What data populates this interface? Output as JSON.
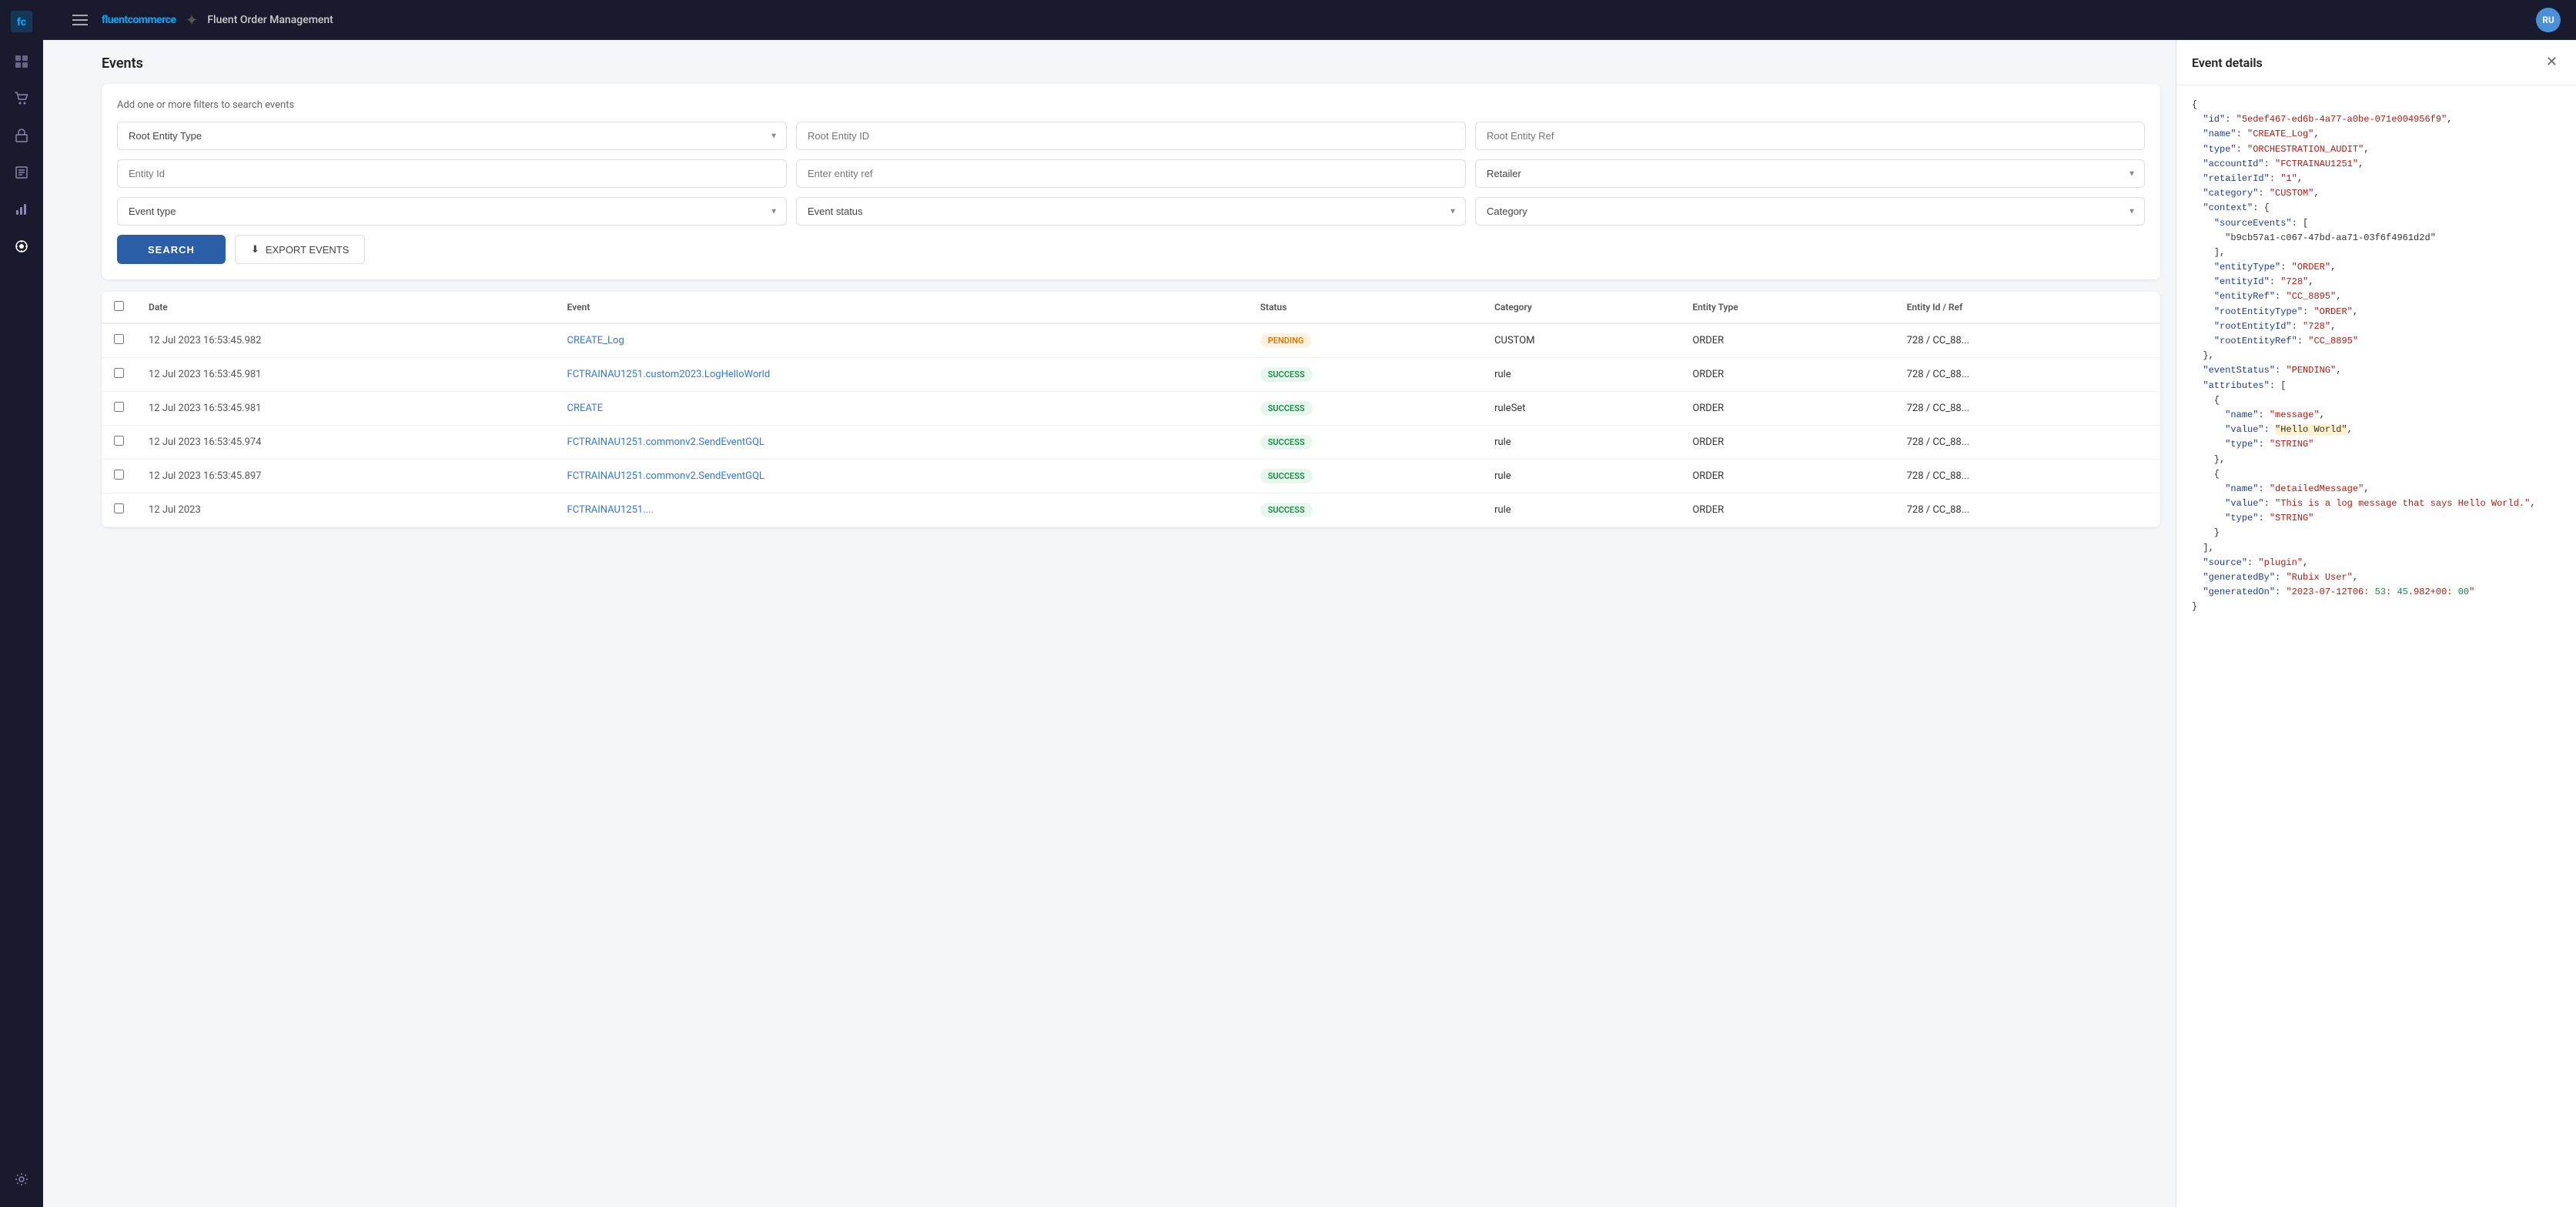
{
  "app": {
    "brand": "fluentcommerce",
    "title": "Fluent Order Management",
    "logo_symbol": "≋"
  },
  "sidebar": {
    "icons": [
      {
        "name": "menu-icon",
        "symbol": "☰",
        "active": false
      },
      {
        "name": "dashboard-icon",
        "symbol": "⊞",
        "active": false
      },
      {
        "name": "orders-icon",
        "symbol": "🛒",
        "active": false
      },
      {
        "name": "inventory-icon",
        "symbol": "📦",
        "active": false
      },
      {
        "name": "catalog-icon",
        "symbol": "📋",
        "active": false
      },
      {
        "name": "reports-icon",
        "symbol": "📊",
        "active": false
      },
      {
        "name": "rules-icon",
        "symbol": "⚙",
        "active": true
      },
      {
        "name": "settings-icon",
        "symbol": "⚙",
        "active": false
      }
    ]
  },
  "page": {
    "title": "Events"
  },
  "filters": {
    "hint": "Add one or more filters to search events",
    "row1": {
      "root_entity_type_placeholder": "Root Entity Type",
      "root_entity_id_placeholder": "Root Entity ID",
      "root_entity_ref_placeholder": "Root Entity Ref"
    },
    "row2": {
      "entity_id_placeholder": "Entity Id",
      "entity_ref_placeholder": "Enter entity ref",
      "retailer_placeholder": "Retailer"
    },
    "row3": {
      "event_type_placeholder": "Event type",
      "event_status_placeholder": "Event status",
      "category_placeholder": "Category"
    },
    "search_label": "SEARCH",
    "export_label": "EXPORT EVENTS"
  },
  "table": {
    "columns": [
      "",
      "Date",
      "Event",
      "Status",
      "Category",
      "Entity Type",
      "Entity Id / Ref"
    ],
    "rows": [
      {
        "date": "12 Jul 2023 16:53:45.982",
        "event": "CREATE_Log",
        "event_link": true,
        "status": "PENDING",
        "status_type": "pending",
        "category": "CUSTOM",
        "entity_type": "ORDER",
        "entity_id_ref": "728 / CC_88..."
      },
      {
        "date": "12 Jul 2023 16:53:45.981",
        "event": "FCTRAINAU1251.custom2023.LogHelloWorld",
        "event_link": true,
        "status": "SUCCESS",
        "status_type": "success",
        "category": "rule",
        "entity_type": "ORDER",
        "entity_id_ref": "728 / CC_88..."
      },
      {
        "date": "12 Jul 2023 16:53:45.981",
        "event": "CREATE",
        "event_link": true,
        "status": "SUCCESS",
        "status_type": "success",
        "category": "ruleSet",
        "entity_type": "ORDER",
        "entity_id_ref": "728 / CC_88..."
      },
      {
        "date": "12 Jul 2023 16:53:45.974",
        "event": "FCTRAINAU1251.commonv2.SendEventGQL",
        "event_link": true,
        "status": "SUCCESS",
        "status_type": "success",
        "category": "rule",
        "entity_type": "ORDER",
        "entity_id_ref": "728 / CC_88..."
      },
      {
        "date": "12 Jul 2023 16:53:45.897",
        "event": "FCTRAINAU1251.commonv2.SendEventGQL",
        "event_link": true,
        "status": "SUCCESS",
        "status_type": "success",
        "category": "rule",
        "entity_type": "ORDER",
        "entity_id_ref": "728 / CC_88..."
      },
      {
        "date": "12 Jul 2023",
        "event": "FCTRAINAU1251....",
        "event_link": true,
        "status": "SUCCESS",
        "status_type": "success",
        "category": "rule",
        "entity_type": "ORDER",
        "entity_id_ref": "728 / CC_88..."
      }
    ]
  },
  "detail_panel": {
    "title": "Event details",
    "json_content": "{\n  \"id\": \"5edef467-ed6b-4a77-a0be-071e004956f9\",\n  \"name\": \"CREATE_Log\",\n  \"type\": \"ORCHESTRATION_AUDIT\",\n  \"accountId\": \"FCTRAINAU1251\",\n  \"retailerId\": \"1\",\n  \"category\": \"CUSTOM\",\n  \"context\": {\n    \"sourceEvents\": [\n      \"b9cb57a1-c067-47bd-aa71-03f6f4961d2d\"\n    ],\n    \"entityType\": \"ORDER\",\n    \"entityId\": \"728\",\n    \"entityRef\": \"CC_8895\",\n    \"rootEntityType\": \"ORDER\",\n    \"rootEntityId\": \"728\",\n    \"rootEntityRef\": \"CC_8895\"\n  },\n  \"eventStatus\": \"PENDING\",\n  \"attributes\": [\n    {\n      \"name\": \"message\",\n      \"value\": \"Hello World\",\n      \"type\": \"STRING\"\n    },\n    {\n      \"name\": \"detailedMessage\",\n      \"value\": \"This is a log message that says Hello World.\",\n      \"type\": \"STRING\"\n    }\n  ],\n  \"source\": \"plugin\",\n  \"generatedBy\": \"Rubix User\",\n  \"generatedOn\": \"2023-07-12T06:53:45.982+00:00\"\n}"
  }
}
